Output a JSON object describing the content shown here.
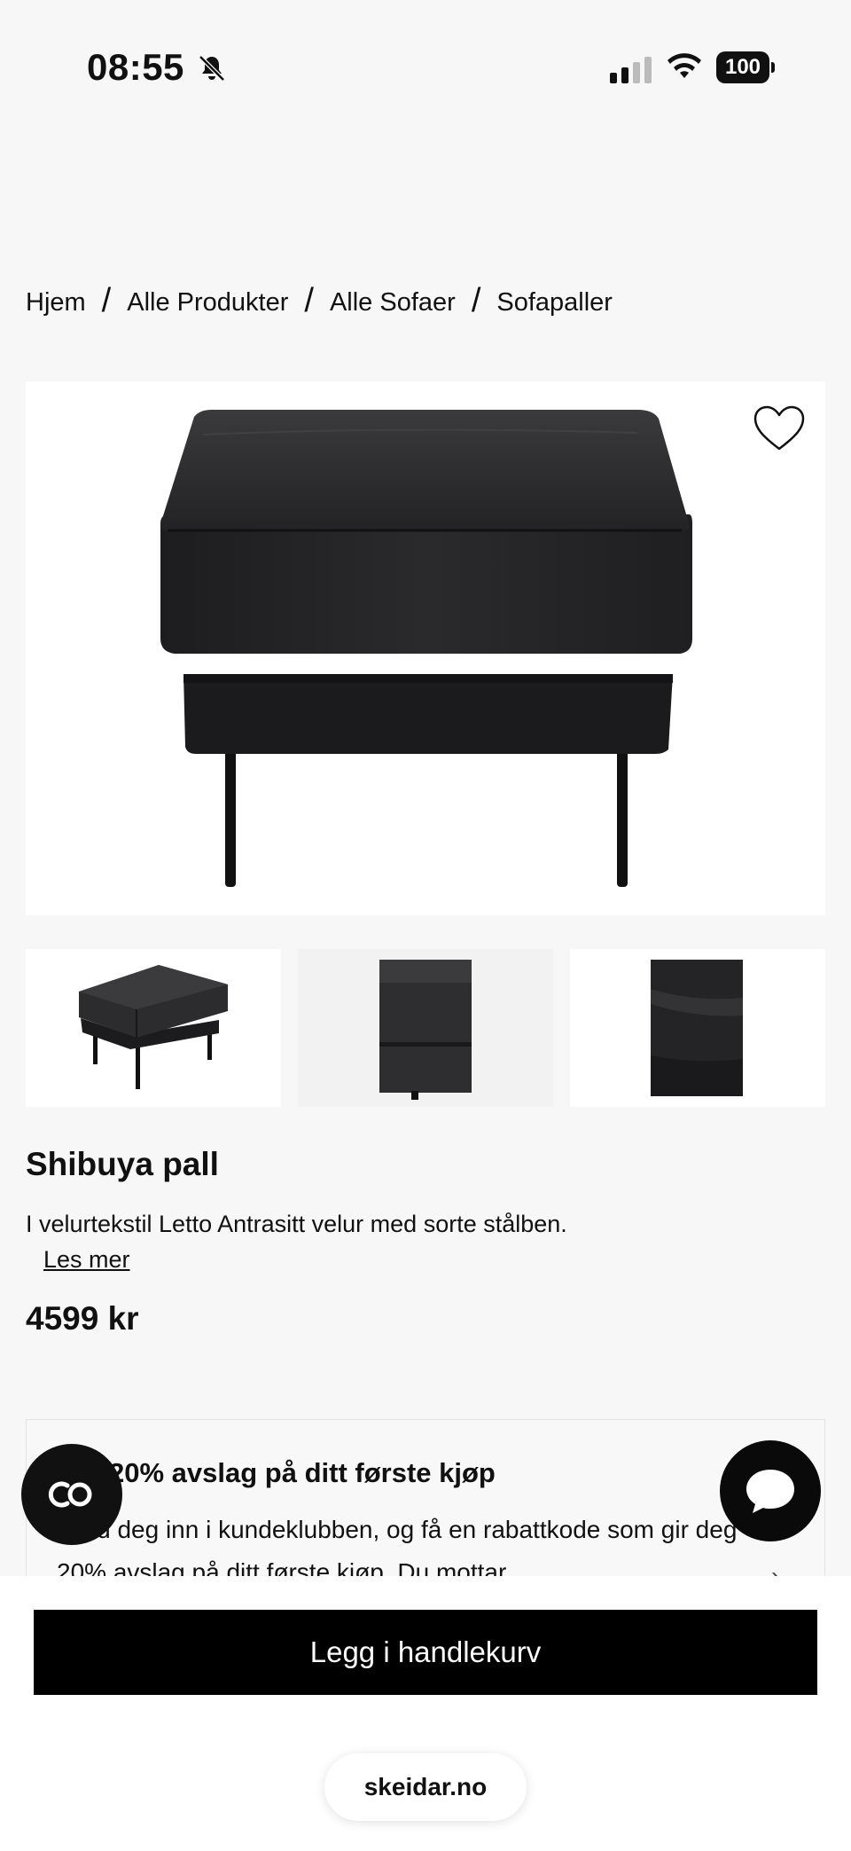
{
  "status_bar": {
    "time": "08:55",
    "battery": "100",
    "icons": [
      "bell-slash-icon",
      "cellular-signal-icon",
      "wifi-icon",
      "battery-icon"
    ]
  },
  "breadcrumb": {
    "items": [
      "Hjem",
      "Alle Produkter",
      "Alle Sofaer",
      "Sofapaller"
    ],
    "separator": "/"
  },
  "product": {
    "name": "Shibuya pall",
    "description": "I velurtekstil Letto Antrasitt velur med sorte stålben.",
    "read_more": "Les mer",
    "price": "4599 kr",
    "favorite_icon": "heart-outline-icon",
    "thumbnail_count": 3
  },
  "promo": {
    "title": "20% avslag på ditt første kjøp",
    "text": "Meld deg inn i kundeklubben, og få en rabattkode som gir deg 20% avslag på ditt første kjøp. Du mottar"
  },
  "actions": {
    "add_to_cart": "Legg i handlekurv"
  },
  "browser": {
    "url": "skeidar.no"
  },
  "colors": {
    "background": "#f7f7f7",
    "primary_button": "#000000",
    "text": "#111111"
  }
}
